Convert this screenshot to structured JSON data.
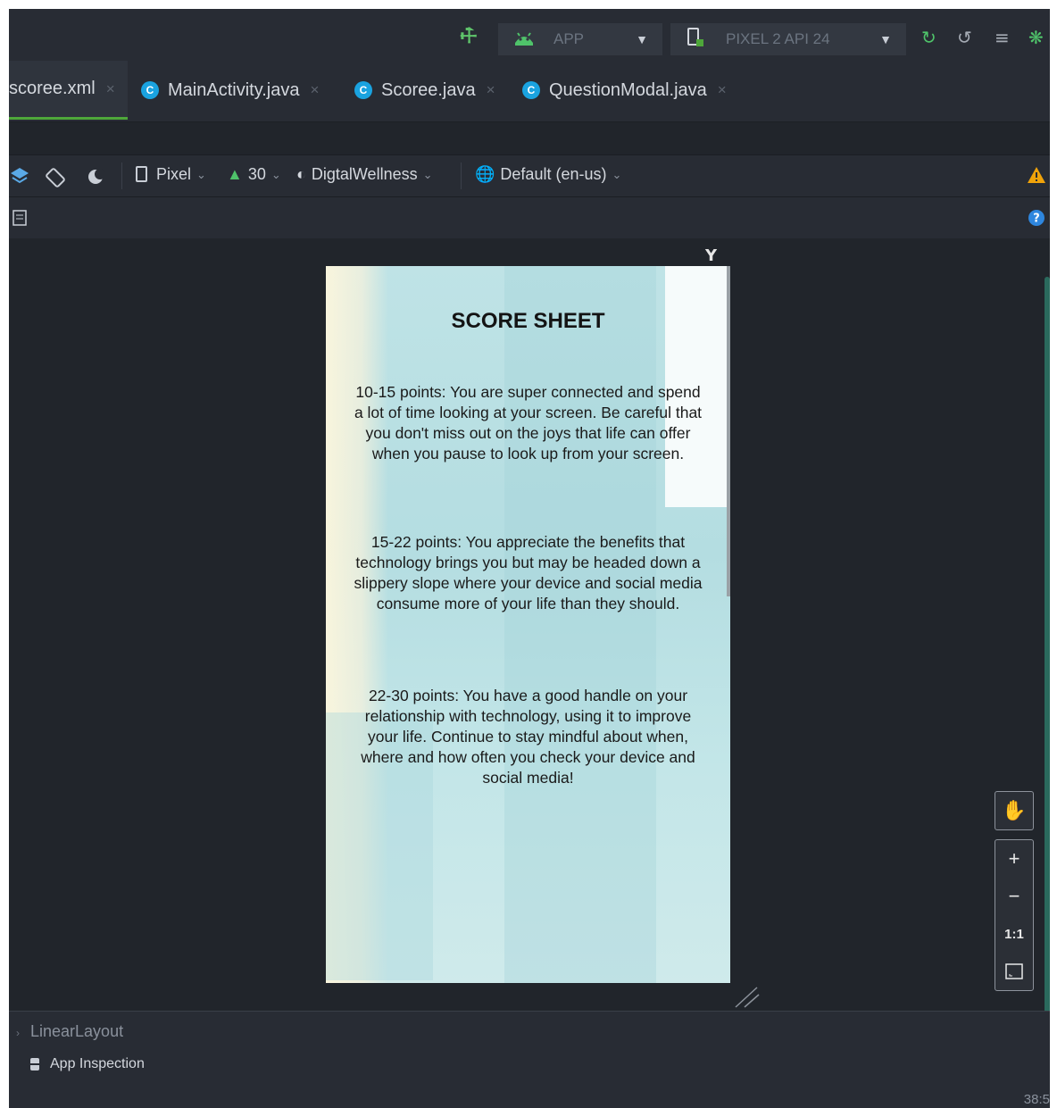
{
  "toolbar": {
    "config": "APP",
    "device": "PIXEL 2 API 24"
  },
  "tabs": [
    {
      "label": "scoree.xml",
      "active": true,
      "badge": ""
    },
    {
      "label": "MainActivity.java",
      "active": false,
      "badge": "C"
    },
    {
      "label": "Scoree.java",
      "active": false,
      "badge": "C"
    },
    {
      "label": "QuestionModal.java",
      "active": false,
      "badge": "C"
    }
  ],
  "design_toolbar": {
    "device": "Pixel",
    "api": "30",
    "theme": "DigtalWellness",
    "locale": "Default (en-us)"
  },
  "preview": {
    "title": "SCORE SHEET",
    "para1": "10-15 points: You are super connected and spend a lot of time looking at your screen. Be careful that you don't miss out on the joys that life can offer when you pause to look up from your screen.",
    "para2": "15-22 points: You appreciate the benefits that technology brings you but may be headed down a slippery slope where your device and social media consume more of your life than they should.",
    "para3": "22-30 points: You have a good handle on your relationship with technology, using it to improve your life. Continue to stay mindful about when, where and how often you check your device and social media!"
  },
  "zoom": {
    "plus": "+",
    "minus": "−",
    "actual": "1:1"
  },
  "bottom": {
    "breadcrumb": "LinearLayout",
    "app_inspection": "App Inspection",
    "clock": "38:5"
  },
  "colors": {
    "accent_green": "#4ea73a",
    "badge_blue": "#1aa3e0",
    "warning": "#f0a30a",
    "help": "#2e86de"
  }
}
